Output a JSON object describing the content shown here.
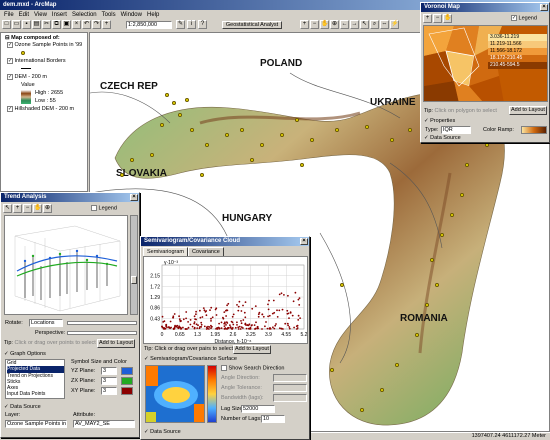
{
  "app": {
    "title": "dem.mxd - ArcMap"
  },
  "menu": [
    "File",
    "Edit",
    "View",
    "Insert",
    "Selection",
    "Tools",
    "Window",
    "Help"
  ],
  "toolbar": {
    "scale": "1:2,850,000",
    "analyst": "Geostatistical Analyst"
  },
  "toc": {
    "root": "Map composed of:",
    "layers": [
      {
        "label": "Ozone Sample Points in '99"
      },
      {
        "label": "International Borders"
      },
      {
        "label": "DEM - 200 m"
      },
      {
        "label": "Value"
      },
      {
        "label": "High : 2655"
      },
      {
        "label": "Low : 55"
      },
      {
        "label": "Hillshaded DEM - 200 m"
      }
    ]
  },
  "map": {
    "countries": [
      "POLAND",
      "CZECH REP",
      "UKRAINE",
      "SLOVAKIA",
      "HUNGARY",
      "ROMANIA"
    ]
  },
  "status": "1397407.24  4611172.27 Meter",
  "voronoi": {
    "title": "Voronoi Map",
    "legend": "Legend",
    "values": [
      "3.036-11.219",
      "11.219-11.566",
      "11.566-18.172",
      "18.172-210.45",
      "210.45-594.5"
    ],
    "tip_label": "Tip:",
    "tip": "Click on polygon to select",
    "add_button": "Add to Layout",
    "props": "Properties",
    "type_label": "Type:",
    "type_value": "IQR",
    "ramp_label": "Color Ramp:",
    "datasource": "Data Source"
  },
  "trend": {
    "title": "Trend Analysis",
    "legend": "Legend",
    "rotate_label": "Rotate:",
    "rotate_value": "Locations",
    "perspective": "Perspective:",
    "tip_label": "Tip:",
    "tip": "Click or drag over points to select",
    "add_button": "Add to Layout",
    "graph_options": "Graph Options",
    "graph_items": [
      "Grid",
      "Projected Data",
      "Trend on Projections",
      "Sticks",
      "Axes",
      "Input Data Points"
    ],
    "symbol_label": "Symbol Size and Color",
    "planes": [
      {
        "label": "YZ Plane:",
        "value": "3"
      },
      {
        "label": "ZX Plane:",
        "value": "3"
      },
      {
        "label": "XY Plane:",
        "value": "3"
      }
    ],
    "datasource": "Data Source",
    "layer_label": "Layer:",
    "attr_label": "Attribute:",
    "layer_value": "Ozone Sample Points in '99",
    "attr_value": "AV_MAY2_SE"
  },
  "semi": {
    "title": "Semivariogram/Covariance Cloud",
    "tabs": [
      "Semivariogram",
      "Covariance"
    ],
    "tip_label": "Tip:",
    "tip": "Click or drag over pairs to select",
    "add_button": "Add to Layout",
    "surface": "Semivariogram/Covariance Surface",
    "show_search": "Show Search Direction",
    "fields": [
      "Angle Direction:",
      "Angle Tolerance:",
      "Bandwidth (lags):"
    ],
    "lag_size_label": "Lag Size:",
    "lag_size": "52000",
    "lags_label": "Number of Lags:",
    "lags": "10",
    "datasource": "Data Source"
  },
  "chart_data": {
    "type": "scatter",
    "xlabel": "Distance, h·10⁻⁶",
    "y_exp": "γ·10⁻³",
    "x_ticks": [
      "0",
      "0.65",
      "1.3",
      "1.95",
      "2.6",
      "3.25",
      "3.9",
      "4.55",
      "5.2"
    ],
    "y_ticks": [
      "0.43",
      "0.86",
      "1.29",
      "1.72",
      "2.15"
    ],
    "xlim": [
      0,
      5.2
    ],
    "ylim": [
      0,
      3
    ],
    "grid": true
  },
  "colors": {
    "titlebar": "#0a246a",
    "point": "#f5e400",
    "scatter": "#8b0000"
  }
}
